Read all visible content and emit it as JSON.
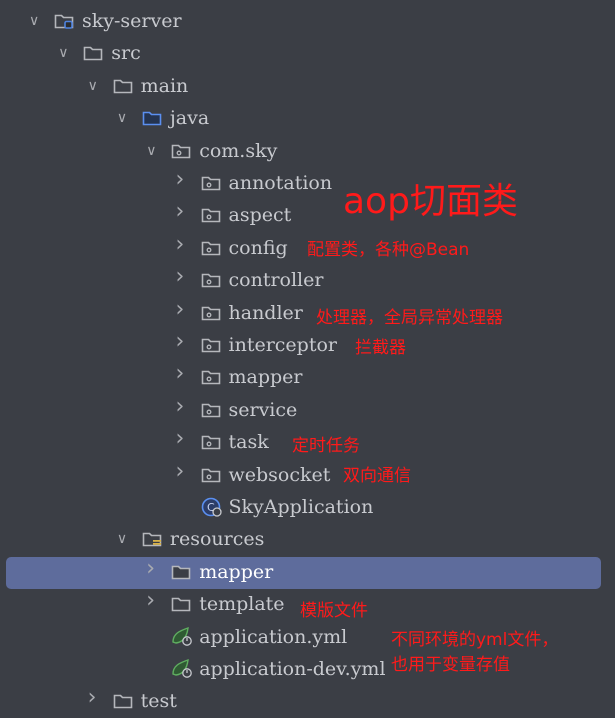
{
  "tree": [
    {
      "label": "sky-server",
      "level": 0,
      "chev": "down",
      "icon": "module-folder"
    },
    {
      "label": "src",
      "level": 1,
      "chev": "down",
      "icon": "folder"
    },
    {
      "label": "main",
      "level": 2,
      "chev": "down",
      "icon": "folder"
    },
    {
      "label": "java",
      "level": 3,
      "chev": "down",
      "icon": "source-folder"
    },
    {
      "label": "com.sky",
      "level": 4,
      "chev": "down",
      "icon": "package"
    },
    {
      "label": "annotation",
      "level": 5,
      "chev": "right",
      "icon": "package"
    },
    {
      "label": "aspect",
      "level": 5,
      "chev": "right",
      "icon": "package"
    },
    {
      "label": "config",
      "level": 5,
      "chev": "right",
      "icon": "package"
    },
    {
      "label": "controller",
      "level": 5,
      "chev": "right",
      "icon": "package"
    },
    {
      "label": "handler",
      "level": 5,
      "chev": "right",
      "icon": "package"
    },
    {
      "label": "interceptor",
      "level": 5,
      "chev": "right",
      "icon": "package"
    },
    {
      "label": "mapper",
      "level": 5,
      "chev": "right",
      "icon": "package"
    },
    {
      "label": "service",
      "level": 5,
      "chev": "right",
      "icon": "package"
    },
    {
      "label": "task",
      "level": 5,
      "chev": "right",
      "icon": "package"
    },
    {
      "label": "websocket",
      "level": 5,
      "chev": "right",
      "icon": "package"
    },
    {
      "label": "SkyApplication",
      "level": 5,
      "chev": "",
      "icon": "spring-boot-class"
    },
    {
      "label": "resources",
      "level": 3,
      "chev": "down",
      "icon": "resources-folder"
    },
    {
      "label": "mapper",
      "level": 4,
      "chev": "right",
      "icon": "folder",
      "selected": true
    },
    {
      "label": "template",
      "level": 4,
      "chev": "right",
      "icon": "folder"
    },
    {
      "label": "application.yml",
      "level": 4,
      "chev": "",
      "icon": "spring-yml"
    },
    {
      "label": "application-dev.yml",
      "level": 4,
      "chev": "",
      "icon": "spring-yml"
    },
    {
      "label": "test",
      "level": 2,
      "chev": "right",
      "icon": "folder"
    }
  ],
  "annotations": {
    "aspect": "aop切面类",
    "config": "配置类，各种@Bean",
    "handler": "处理器，全局异常处理器",
    "interceptor": "拦截器",
    "task": "定时任务",
    "websocket": "双向通信",
    "template": "模版文件",
    "yml_line1": "不同环境的yml文件，",
    "yml_line2": "也用于变量存值"
  },
  "colors": {
    "background": "#3b3e45",
    "selection": "#5e6c9c",
    "annotation": "#ff1a1a",
    "text": "#c8cacf"
  }
}
